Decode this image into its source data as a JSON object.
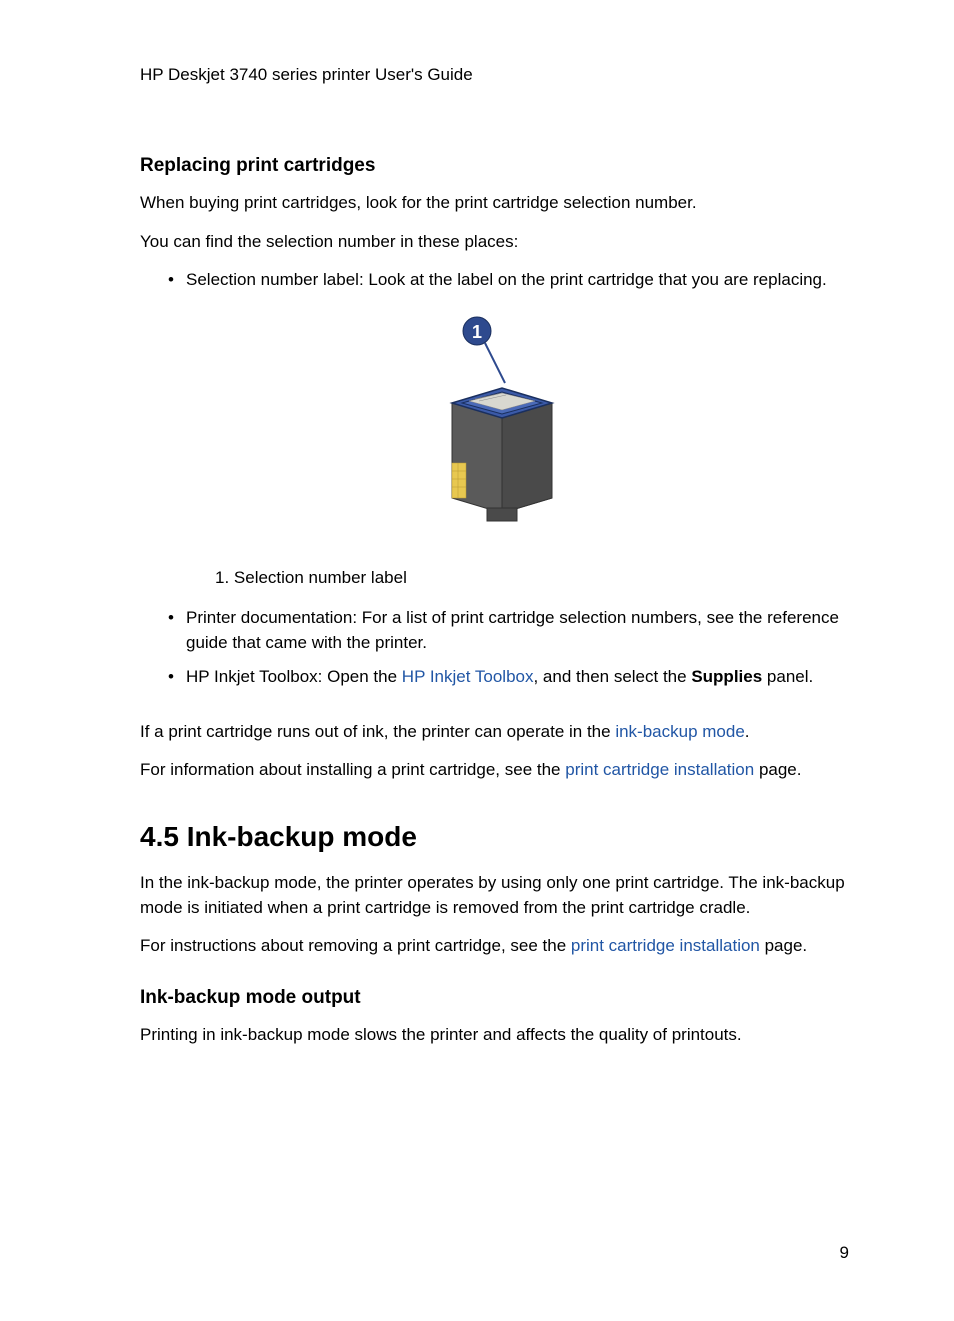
{
  "header": "HP Deskjet 3740 series printer User's Guide",
  "section1": {
    "heading": "Replacing print cartridges",
    "para1": "When buying print cartridges, look for the print cartridge selection number.",
    "para2": "You can find the selection number in these places:",
    "bullet1": "Selection number label: Look at the label on the print cartridge that you are replacing.",
    "caption": "1. Selection number label",
    "bullet2": "Printer documentation: For a list of print cartridge selection numbers, see the reference guide that came with the printer.",
    "bullet3_prefix": "HP Inkjet Toolbox: Open the ",
    "bullet3_link": "HP Inkjet Toolbox",
    "bullet3_mid": ", and then select the ",
    "bullet3_bold": "Supplies",
    "bullet3_suffix": " panel.",
    "para3_prefix": "If a print cartridge runs out of ink, the printer can operate in the ",
    "para3_link": "ink-backup mode",
    "para3_suffix": ".",
    "para4_prefix": "For information about installing a print cartridge, see the ",
    "para4_link": "print cartridge installation",
    "para4_suffix": " page."
  },
  "section2": {
    "heading": "4.5  Ink-backup mode",
    "para1": "In the ink-backup mode, the printer operates by using only one print cartridge. The ink-backup mode is initiated when a print cartridge is removed from the print cartridge cradle.",
    "para2_prefix": "For instructions about removing a print cartridge, see the ",
    "para2_link": "print cartridge installation",
    "para2_suffix": " page.",
    "subheading": "Ink-backup mode output",
    "para3": "Printing in ink-backup mode slows the printer and affects the quality of printouts."
  },
  "pageNumber": "9"
}
